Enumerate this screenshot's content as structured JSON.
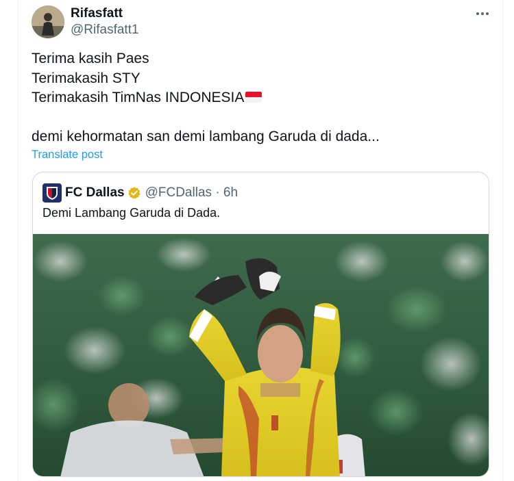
{
  "post": {
    "display_name": "Rifasfatt",
    "handle": "@Rifasfatt1",
    "more_icon": "more-horizontal-icon",
    "lines": [
      "Terima kasih Paes",
      "Terimakasih STY",
      "Terimakasih TimNas INDONESIA",
      "demi kehormatan san demi lambang Garuda di dada..."
    ],
    "flag_icon": "indonesia-flag-emoji",
    "translate_label": "Translate post"
  },
  "quoted": {
    "display_name": "FC Dallas",
    "handle": "@FCDallas",
    "separator": "·",
    "time": "6h",
    "text": "Demi Lambang Garuda di Dada.",
    "verified_icon": "gold-verified-badge-icon",
    "media_alt": "goalkeeper in yellow kit applauding crowd"
  },
  "colors": {
    "link": "#1d9bf0",
    "secondary_text": "#536471",
    "verified_gold": "#e2b719",
    "border": "#cfd9de"
  }
}
